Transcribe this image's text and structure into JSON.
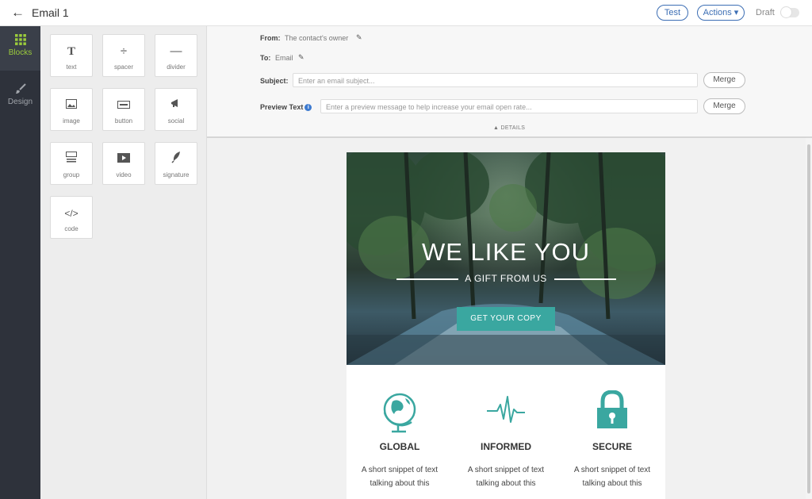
{
  "topbar": {
    "back_icon": "arrow-left-icon",
    "title": "Email 1",
    "test_label": "Test",
    "actions_label": "Actions ▾",
    "draft_label": "Draft"
  },
  "rail": {
    "blocks_label": "Blocks",
    "design_label": "Design",
    "accent_color": "#9ccc3c"
  },
  "palette": {
    "tiles": [
      {
        "label": "text",
        "icon": "T"
      },
      {
        "label": "spacer",
        "icon": "÷"
      },
      {
        "label": "divider",
        "icon": "—"
      },
      {
        "label": "image",
        "icon": "image-icon"
      },
      {
        "label": "button",
        "icon": "button-icon"
      },
      {
        "label": "social",
        "icon": "megaphone-icon"
      },
      {
        "label": "group",
        "icon": "group-icon"
      },
      {
        "label": "video",
        "icon": "video-icon"
      },
      {
        "label": "signature",
        "icon": "feather-icon"
      },
      {
        "label": "code",
        "icon": "</>"
      }
    ]
  },
  "form": {
    "from_label": "From:",
    "from_value": "The contact's owner",
    "to_label": "To:",
    "to_value": "Email",
    "subject_label": "Subject:",
    "subject_placeholder": "Enter an email subject...",
    "preview_label": "Preview Text",
    "preview_placeholder": "Enter a preview message to help increase your email open rate...",
    "merge_label": "Merge",
    "details_label": "DETAILS"
  },
  "email": {
    "hero_title": "WE LIKE YOU",
    "hero_subtitle": "A GIFT FROM US",
    "hero_button": "GET YOUR COPY",
    "accent_color": "#3aa7a0",
    "features": [
      {
        "title": "GLOBAL",
        "text": "A short snippet of text talking about this",
        "icon": "globe-icon"
      },
      {
        "title": "INFORMED",
        "text": "A short snippet of text talking about this",
        "icon": "heartbeat-icon"
      },
      {
        "title": "SECURE",
        "text": "A short snippet of text talking about this",
        "icon": "lock-icon"
      }
    ]
  }
}
